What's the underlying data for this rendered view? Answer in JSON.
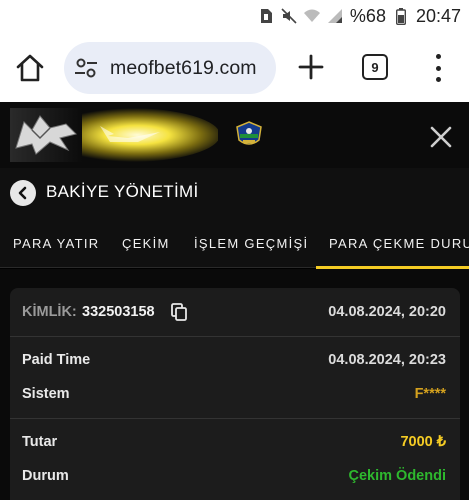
{
  "status_bar": {
    "battery_percent": "%68",
    "time": "20:47",
    "icons": [
      "sim-icon",
      "mute-icon",
      "wifi-icon",
      "signal-icon",
      "battery-icon"
    ]
  },
  "browser": {
    "url": "meofbet619.com",
    "tab_count": "9"
  },
  "page": {
    "title": "BAKİYE YÖNETİMİ",
    "tabs": [
      {
        "label": "PARA YATIR"
      },
      {
        "label": "ÇEKİM"
      },
      {
        "label": "İŞLEM GEÇMİŞİ"
      },
      {
        "label": "PARA ÇEKME DURUM",
        "active": true
      }
    ]
  },
  "withdrawal": {
    "id_label": "KİMLİK:",
    "id_value": "332503158",
    "created_at": "04.08.2024, 20:20",
    "rows": [
      {
        "label": "Paid Time",
        "value": "04.08.2024, 20:23"
      },
      {
        "label": "Sistem",
        "value": "F****"
      },
      {
        "label": "Tutar",
        "value": "7000 ₺"
      },
      {
        "label": "Durum",
        "value": "Çekim Ödendi"
      }
    ]
  },
  "colors": {
    "accent_yellow": "#f5cc24",
    "system_value": "#d4a11e",
    "status_green": "#2eb82e",
    "card_bg": "#1c1c1c"
  }
}
